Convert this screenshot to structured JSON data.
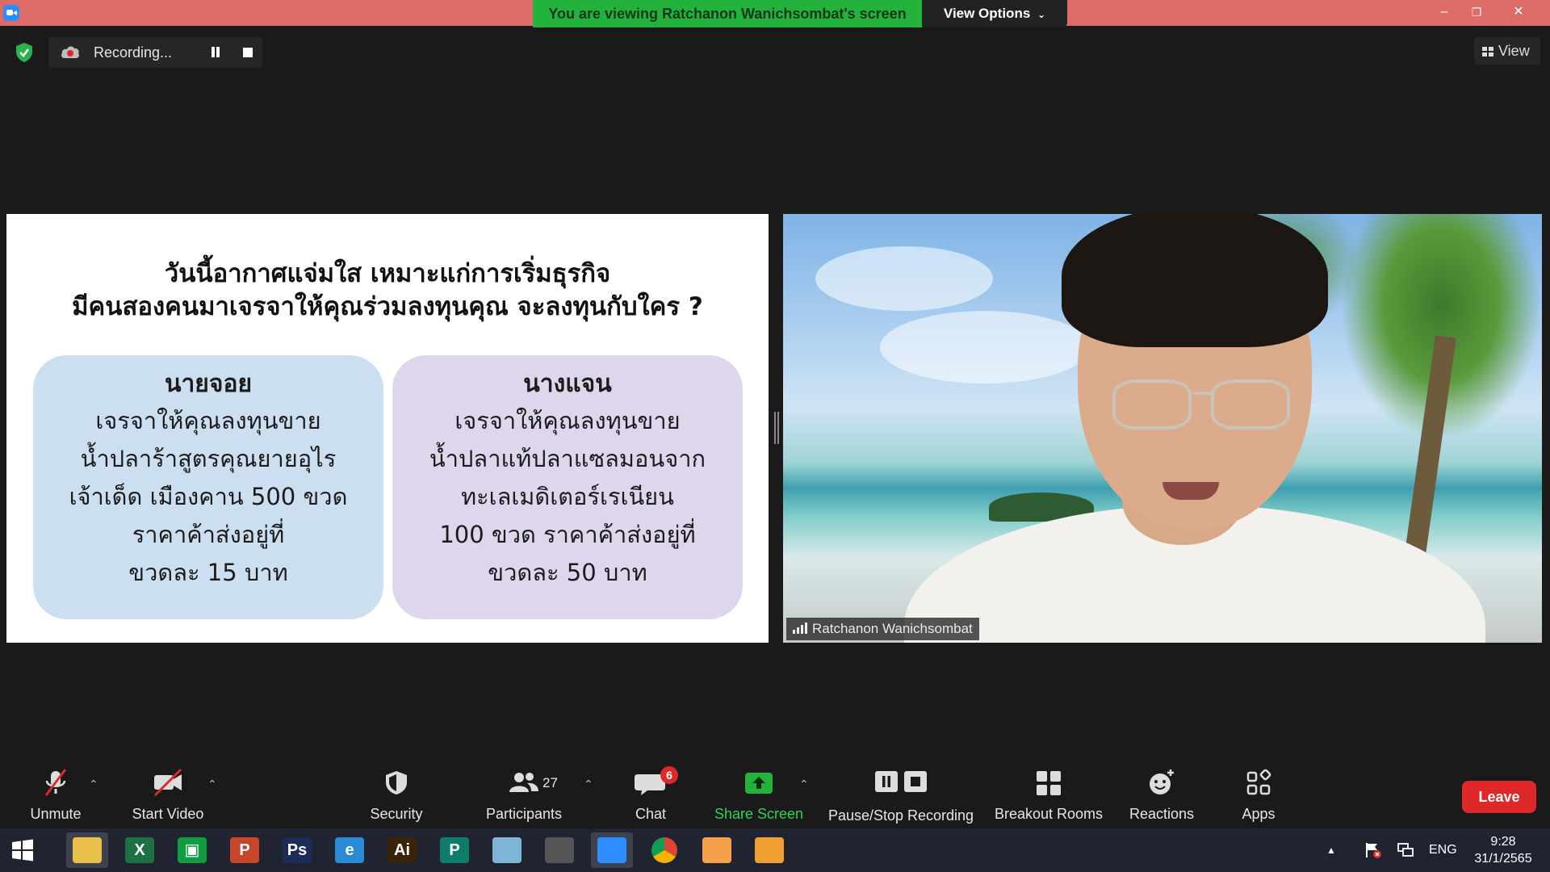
{
  "titlebar": {
    "viewing_banner": "You are viewing Ratchanon Wanichsombat's screen",
    "view_options": "View Options",
    "minimize": "–",
    "restore": "❐",
    "close": "✕"
  },
  "topbar": {
    "recording_label": "Recording...",
    "view_label": "View"
  },
  "slide": {
    "title_line1": "วันนี้อากาศแจ่มใส เหมาะแก่การเริ่มธุรกิจ",
    "title_line2": "มีคนสองคนมาเจรจาให้คุณร่วมลงทุนคุณ จะลงทุนกับใคร ?",
    "card_left": {
      "name": "นายจอย",
      "lines": [
        "เจรจาให้คุณลงทุนขาย",
        "น้ำปลาร้าสูตรคุณยายอุไร",
        "เจ้าเด็ด เมืองคาน 500 ขวด",
        "ราคาค้าส่งอยู่ที่",
        "ขวดละ 15 บาท"
      ]
    },
    "card_right": {
      "name": "นางแจน",
      "lines": [
        "เจรจาให้คุณลงทุนขาย",
        "น้ำปลาแท้ปลาแซลมอนจาก",
        "ทะเลเมดิเตอร์เรเนียน",
        "100 ขวด ราคาค้าส่งอยู่ที่",
        "ขวดละ 50 บาท"
      ]
    }
  },
  "video": {
    "participant_name": "Ratchanon Wanichsombat"
  },
  "toolbar": {
    "unmute": "Unmute",
    "start_video": "Start Video",
    "security": "Security",
    "participants": "Participants",
    "participants_count": "27",
    "chat": "Chat",
    "chat_badge": "6",
    "share_screen": "Share Screen",
    "pause_stop_recording": "Pause/Stop Recording",
    "breakout_rooms": "Breakout Rooms",
    "reactions": "Reactions",
    "apps": "Apps",
    "leave": "Leave",
    "caret": "⌃"
  },
  "taskbar": {
    "apps": [
      {
        "name": "File Explorer",
        "glyph": "",
        "color": "#e9c14a"
      },
      {
        "name": "Excel",
        "glyph": "X",
        "color": "#1d7044"
      },
      {
        "name": "Store",
        "glyph": "▣",
        "color": "#0f9d3f"
      },
      {
        "name": "PowerPoint",
        "glyph": "P",
        "color": "#c8452a"
      },
      {
        "name": "Photoshop",
        "glyph": "Ps",
        "color": "#1c2b57"
      },
      {
        "name": "Internet Explorer",
        "glyph": "e",
        "color": "#2a8ad6"
      },
      {
        "name": "Illustrator",
        "glyph": "Ai",
        "color": "#3a2306"
      },
      {
        "name": "Publisher",
        "glyph": "P",
        "color": "#0e7c6b"
      },
      {
        "name": "Notepad",
        "glyph": "",
        "color": "#7fb6d8"
      },
      {
        "name": "HotoCape",
        "glyph": "",
        "color": "#555"
      },
      {
        "name": "Zoom",
        "glyph": "",
        "color": "#2d8cff"
      },
      {
        "name": "Chrome",
        "glyph": "",
        "color": "#ddd"
      },
      {
        "name": "Presenter",
        "glyph": "",
        "color": "#f4a14a"
      },
      {
        "name": "Camera",
        "glyph": "",
        "color": "#f0a030"
      }
    ],
    "language": "ENG",
    "time": "9:28",
    "date": "31/1/2565"
  }
}
